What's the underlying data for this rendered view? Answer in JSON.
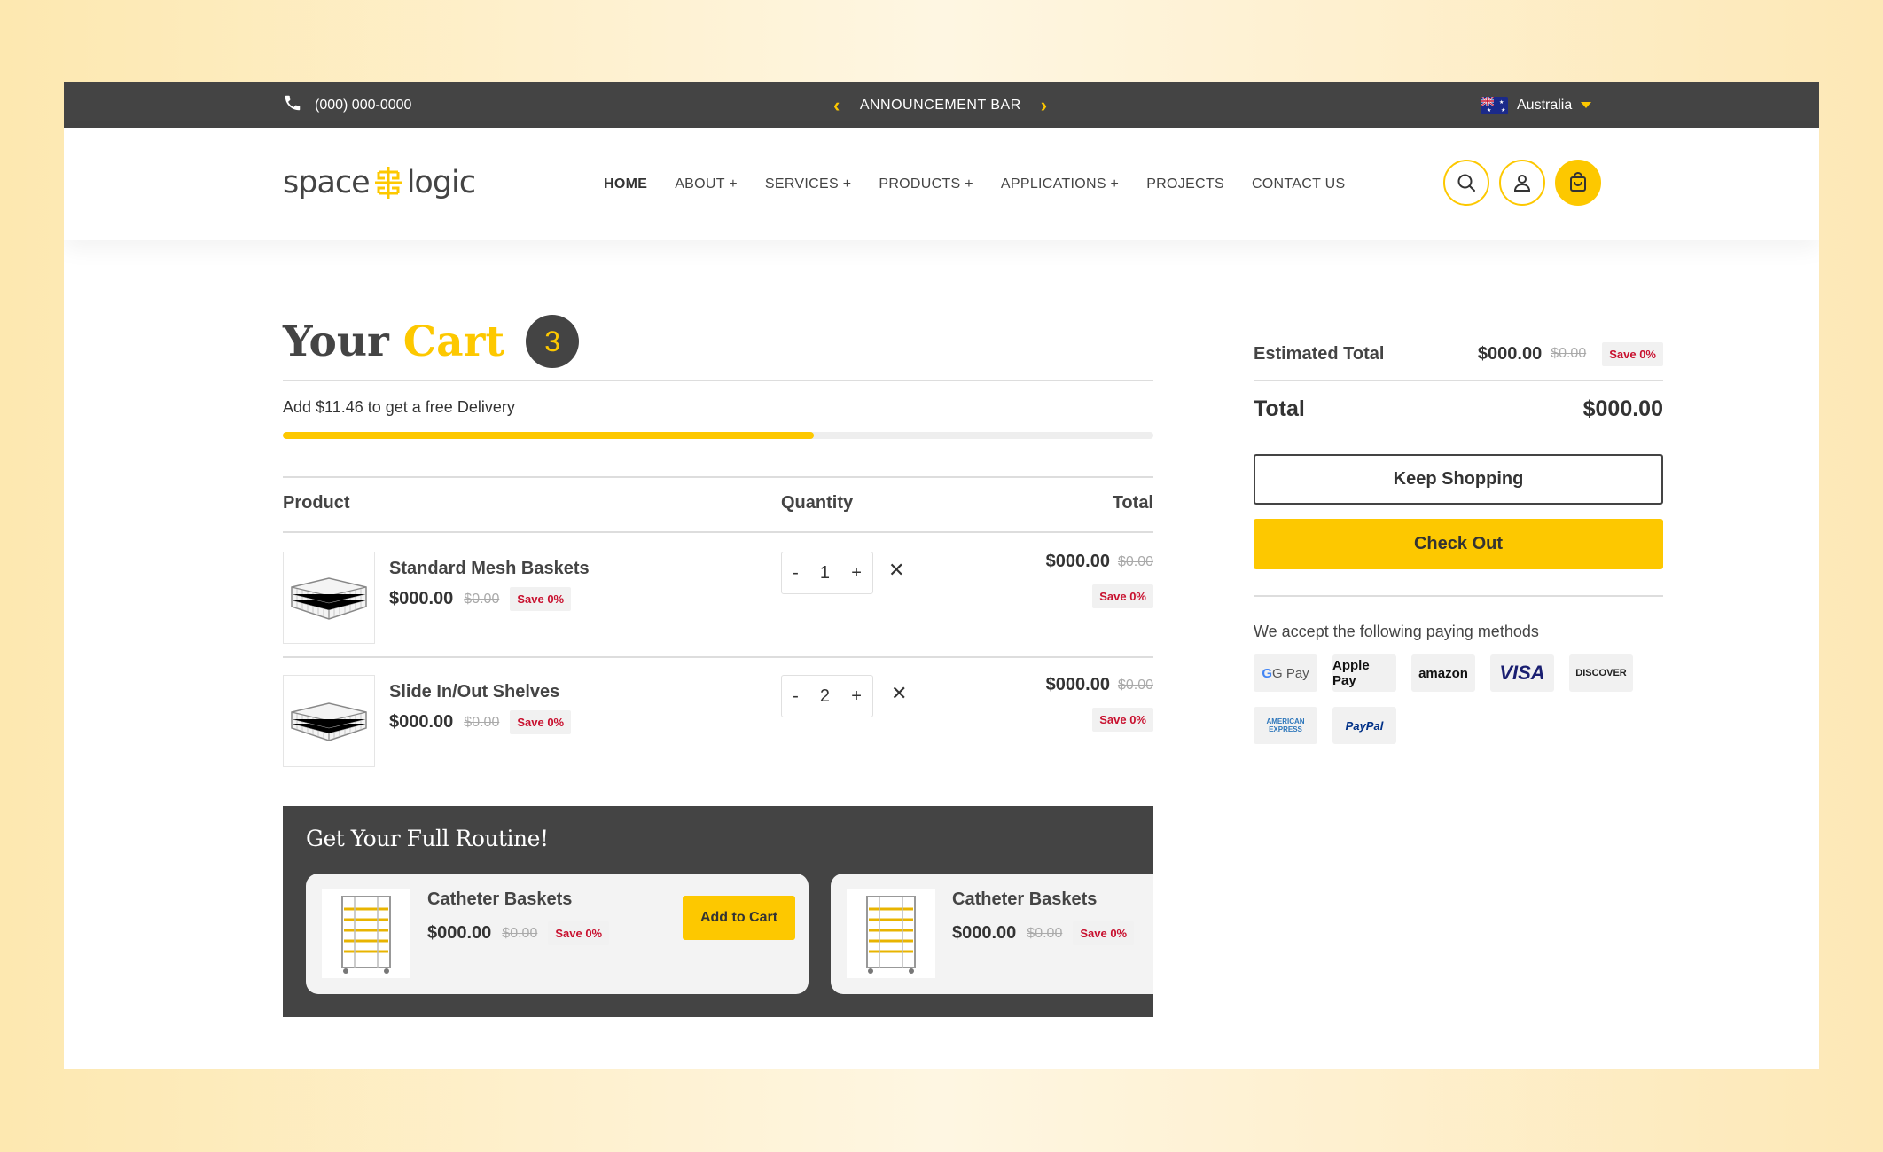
{
  "topbar": {
    "phone": "(000) 000-0000",
    "announcement": "ANNOUNCEMENT BAR",
    "country": "Australia"
  },
  "header": {
    "logo_left": "space",
    "logo_right": "logic",
    "nav": [
      "HOME",
      "ABOUT +",
      "SERVICES +",
      "PRODUCTS +",
      "APPLICATIONS +",
      "PROJECTS",
      "CONTACT US"
    ]
  },
  "cart": {
    "title_part1": "Your",
    "title_part2": "Cart",
    "count": "3",
    "free_delivery_text": "Add $11.46 to get a free Delivery",
    "free_delivery_progress": 0.61,
    "columns": {
      "product": "Product",
      "quantity": "Quantity",
      "total": "Total"
    },
    "items": [
      {
        "name": "Standard Mesh Baskets",
        "price": "$000.00",
        "compare": "$0.00",
        "save": "Save 0%",
        "qty": "1",
        "total": "$000.00",
        "total_compare": "$0.00",
        "total_save": "Save 0%"
      },
      {
        "name": "Slide In/Out Shelves",
        "price": "$000.00",
        "compare": "$0.00",
        "save": "Save 0%",
        "qty": "2",
        "total": "$000.00",
        "total_compare": "$0.00",
        "total_save": "Save 0%"
      }
    ]
  },
  "upsell": {
    "title": "Get Your Full Routine!",
    "cards": [
      {
        "name": "Catheter Baskets",
        "price": "$000.00",
        "compare": "$0.00",
        "save": "Save 0%",
        "button": "Add to Cart"
      },
      {
        "name": "Catheter Baskets",
        "price": "$000.00",
        "compare": "$0.00",
        "save": "Save 0%"
      }
    ]
  },
  "summary": {
    "estimated_label": "Estimated Total",
    "estimated_value": "$000.00",
    "estimated_compare": "$0.00",
    "estimated_save": "Save 0%",
    "total_label": "Total",
    "total_value": "$000.00",
    "keep_shopping": "Keep Shopping",
    "checkout": "Check Out",
    "accept_text": "We accept the following paying methods",
    "payments": [
      "G Pay",
      "Apple Pay",
      "amazon",
      "VISA",
      "DISCOVER",
      "AMERICAN EXPRESS",
      "PayPal"
    ]
  },
  "colors": {
    "accent": "#fdc800",
    "dark": "#444444",
    "sale_red": "#c8102e"
  }
}
